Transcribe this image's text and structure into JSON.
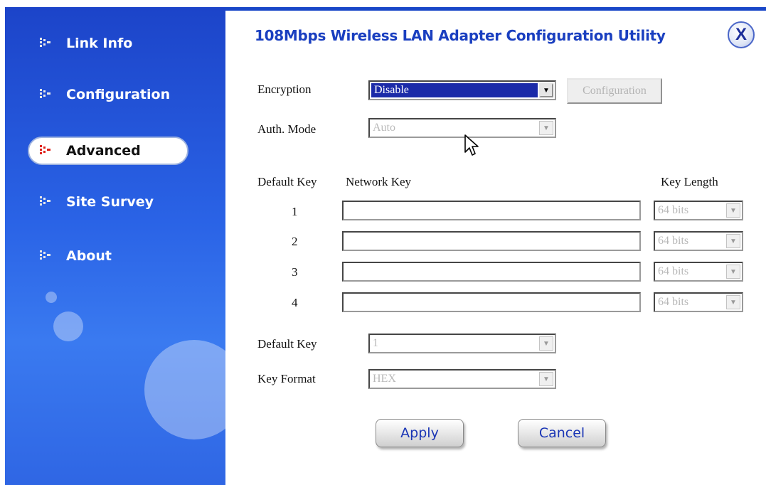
{
  "title": "108Mbps Wireless LAN Adapter Configuration Utility",
  "close_label": "X",
  "sidebar": {
    "items": [
      {
        "label": "Link Info"
      },
      {
        "label": "Configuration"
      },
      {
        "label": "Advanced"
      },
      {
        "label": "Site Survey"
      },
      {
        "label": "About"
      }
    ]
  },
  "encryption": {
    "label": "Encryption",
    "value": "Disable",
    "button_label": "Configuration"
  },
  "auth_mode": {
    "label": "Auth. Mode",
    "value": "Auto"
  },
  "keys_table": {
    "headers": {
      "default_key": "Default Key",
      "network_key": "Network Key",
      "key_length": "Key Length"
    },
    "rows": [
      {
        "index": "1",
        "key": "",
        "length": "64 bits"
      },
      {
        "index": "2",
        "key": "",
        "length": "64 bits"
      },
      {
        "index": "3",
        "key": "",
        "length": "64 bits"
      },
      {
        "index": "4",
        "key": "",
        "length": "64 bits"
      }
    ]
  },
  "default_key": {
    "label": "Default Key",
    "value": "1"
  },
  "key_format": {
    "label": "Key Format",
    "value": "HEX"
  },
  "actions": {
    "apply": "Apply",
    "cancel": "Cancel"
  },
  "colors": {
    "title": "#1a3fc0",
    "sidebar": "#2a63e6",
    "selection": "#1b2aa8"
  }
}
